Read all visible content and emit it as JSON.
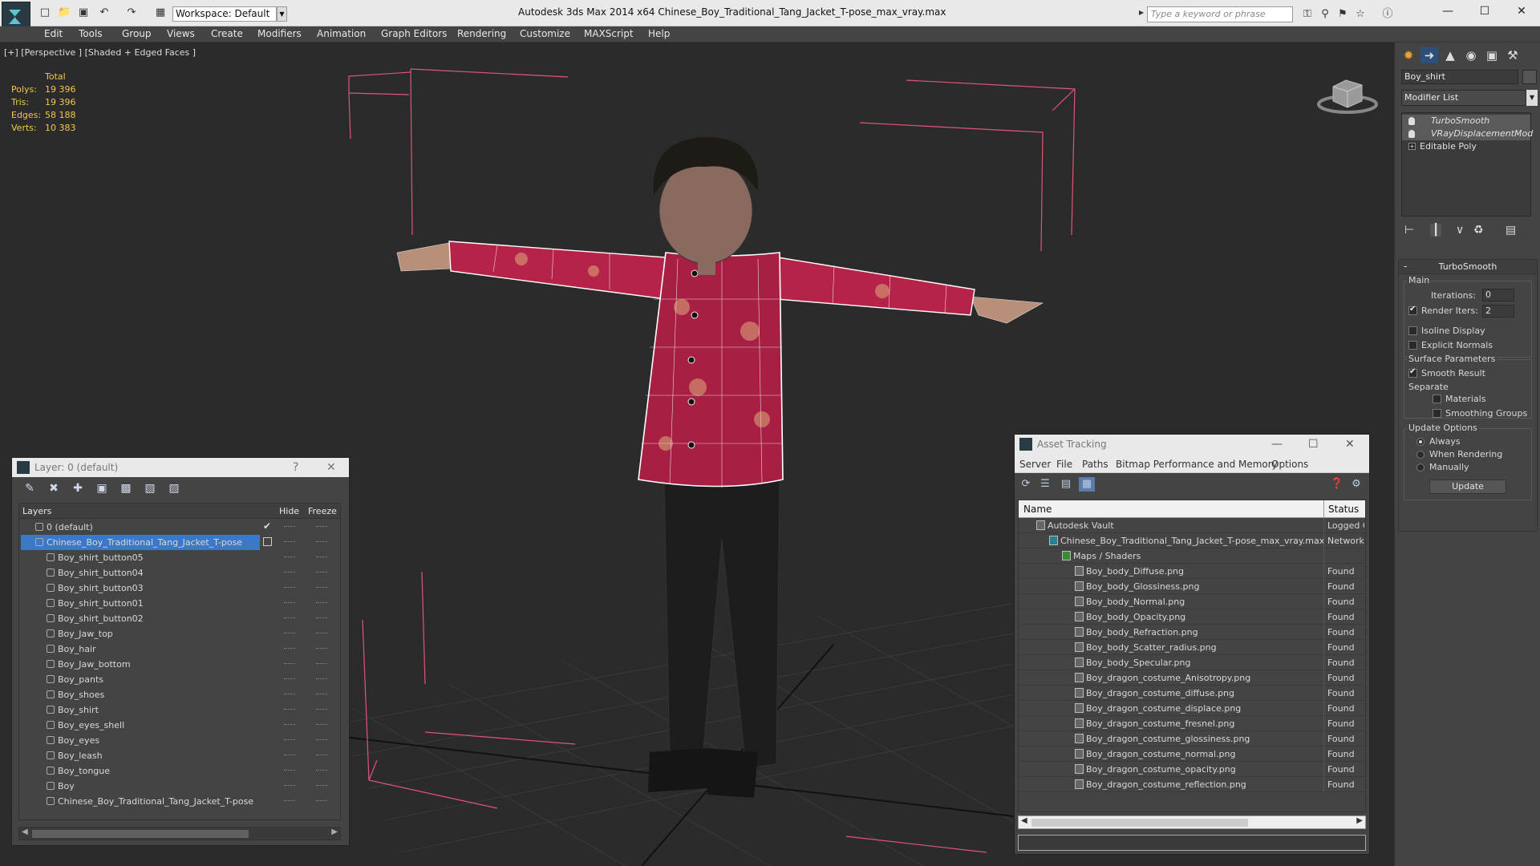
{
  "titlebar": {
    "workspace": "Workspace: Default",
    "title": "Autodesk 3ds Max  2014 x64      Chinese_Boy_Traditional_Tang_Jacket_T-pose_max_vray.max",
    "search_placeholder": "Type a keyword or phrase"
  },
  "menu": [
    "Edit",
    "Tools",
    "Group",
    "Views",
    "Create",
    "Modifiers",
    "Animation",
    "Graph Editors",
    "Rendering",
    "Customize",
    "MAXScript",
    "Help"
  ],
  "viewport": {
    "label": "[+] [Perspective ] [Shaded + Edged Faces ]",
    "stats": {
      "total_label": "Total",
      "rows": [
        {
          "label": "Polys:",
          "value": "19 396"
        },
        {
          "label": "Tris:",
          "value": "19 396"
        },
        {
          "label": "Edges:",
          "value": "58 188"
        },
        {
          "label": "Verts:",
          "value": "10 383"
        }
      ]
    }
  },
  "layer_panel": {
    "title": "Layer: 0 (default)",
    "help": "?",
    "columns": {
      "layers": "Layers",
      "hide": "Hide",
      "freeze": "Freeze"
    },
    "rows": [
      {
        "name": "0 (default)",
        "level": 1
      },
      {
        "name": "Chinese_Boy_Traditional_Tang_Jacket_T-pose",
        "level": 1,
        "selected": true
      },
      {
        "name": "Boy_shirt_button05",
        "level": 2
      },
      {
        "name": "Boy_shirt_button04",
        "level": 2
      },
      {
        "name": "Boy_shirt_button03",
        "level": 2
      },
      {
        "name": "Boy_shirt_button01",
        "level": 2
      },
      {
        "name": "Boy_shirt_button02",
        "level": 2
      },
      {
        "name": "Boy_Jaw_top",
        "level": 2
      },
      {
        "name": "Boy_hair",
        "level": 2
      },
      {
        "name": "Boy_Jaw_bottom",
        "level": 2
      },
      {
        "name": "Boy_pants",
        "level": 2
      },
      {
        "name": "Boy_shoes",
        "level": 2
      },
      {
        "name": "Boy_shirt",
        "level": 2
      },
      {
        "name": "Boy_eyes_shell",
        "level": 2
      },
      {
        "name": "Boy_eyes",
        "level": 2
      },
      {
        "name": "Boy_leash",
        "level": 2
      },
      {
        "name": "Boy_tongue",
        "level": 2
      },
      {
        "name": "Boy",
        "level": 2
      },
      {
        "name": "Chinese_Boy_Traditional_Tang_Jacket_T-pose",
        "level": 2
      }
    ]
  },
  "asset_panel": {
    "title": "Asset Tracking",
    "menu": [
      "Server",
      "File",
      "Paths",
      "Bitmap Performance and Memory",
      "Options"
    ],
    "columns": {
      "name": "Name",
      "status": "Status"
    },
    "rows": [
      {
        "name": "Autodesk Vault",
        "status": "Logged C",
        "level": 1
      },
      {
        "name": "Chinese_Boy_Traditional_Tang_Jacket_T-pose_max_vray.max",
        "status": "Network I",
        "level": 2
      },
      {
        "name": "Maps / Shaders",
        "status": "",
        "level": 3
      },
      {
        "name": "Boy_body_Diffuse.png",
        "status": "Found",
        "level": 4
      },
      {
        "name": "Boy_body_Glossiness.png",
        "status": "Found",
        "level": 4
      },
      {
        "name": "Boy_body_Normal.png",
        "status": "Found",
        "level": 4
      },
      {
        "name": "Boy_body_Opacity.png",
        "status": "Found",
        "level": 4
      },
      {
        "name": "Boy_body_Refraction.png",
        "status": "Found",
        "level": 4
      },
      {
        "name": "Boy_body_Scatter_radius.png",
        "status": "Found",
        "level": 4
      },
      {
        "name": "Boy_body_Specular.png",
        "status": "Found",
        "level": 4
      },
      {
        "name": "Boy_dragon_costume_Anisotropy.png",
        "status": "Found",
        "level": 4
      },
      {
        "name": "Boy_dragon_costume_diffuse.png",
        "status": "Found",
        "level": 4
      },
      {
        "name": "Boy_dragon_costume_displace.png",
        "status": "Found",
        "level": 4
      },
      {
        "name": "Boy_dragon_costume_fresnel.png",
        "status": "Found",
        "level": 4
      },
      {
        "name": "Boy_dragon_costume_glossiness.png",
        "status": "Found",
        "level": 4
      },
      {
        "name": "Boy_dragon_costume_normal.png",
        "status": "Found",
        "level": 4
      },
      {
        "name": "Boy_dragon_costume_opacity.png",
        "status": "Found",
        "level": 4
      },
      {
        "name": "Boy_dragon_costume_reflection.png",
        "status": "Found",
        "level": 4
      }
    ]
  },
  "command_panel": {
    "object_name": "Boy_shirt",
    "modifier_list": "Modifier List",
    "stack": [
      "TurboSmooth",
      "VRayDisplacementMod",
      "Editable Poly"
    ],
    "turbosmooth": {
      "title": "TurboSmooth",
      "main": "Main",
      "iterations_label": "Iterations:",
      "iterations": "0",
      "render_iters_label": "Render Iters:",
      "render_iters": "2",
      "isoline": "Isoline Display",
      "explicit_normals": "Explicit Normals",
      "surface_params": "Surface Parameters",
      "smooth_result": "Smooth Result",
      "separate": "Separate",
      "materials": "Materials",
      "smoothing_groups": "Smoothing Groups",
      "update_options": "Update Options",
      "always": "Always",
      "when_rendering": "When Rendering",
      "manually": "Manually",
      "update_button": "Update"
    }
  },
  "colors": {
    "accent": "#3c78c8",
    "stats": "#f0c84c",
    "bbox": "#e0557a"
  }
}
